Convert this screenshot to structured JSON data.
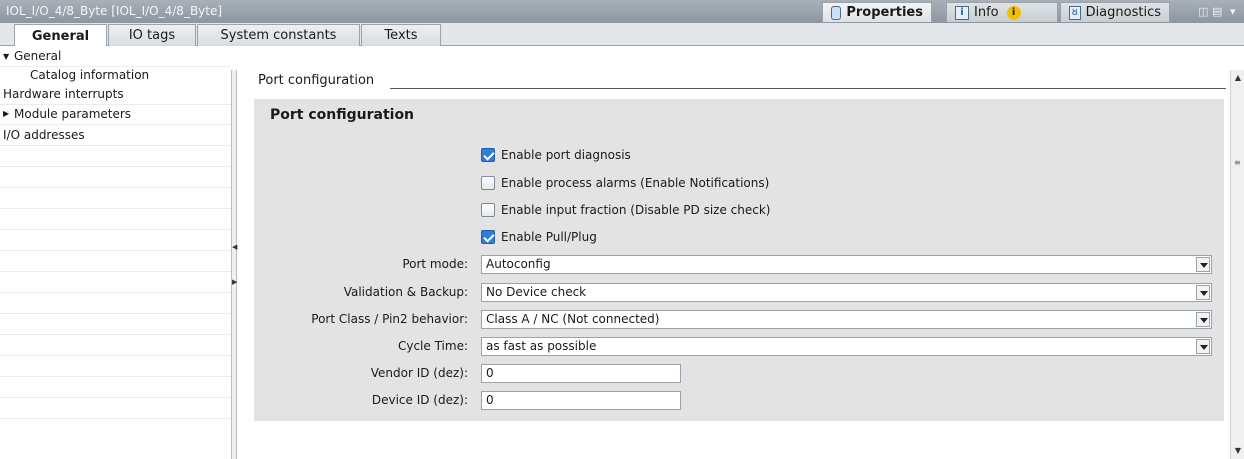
{
  "window": {
    "title": "IOL_I/O_4/8_Byte [IOL_I/O_4/8_Byte]",
    "tabs": {
      "properties": "Properties",
      "info": "Info",
      "info_badge": "i",
      "diagnostics": "Diagnostics"
    }
  },
  "subtabs": [
    "General",
    "IO tags",
    "System constants",
    "Texts"
  ],
  "tree": {
    "general": "General",
    "catalog": "Catalog information",
    "hw_interrupts": "Hardware interrupts",
    "module_params": "Module parameters",
    "io_addresses": "I/O addresses"
  },
  "section": {
    "header": "Port configuration",
    "panel_title": "Port configuration"
  },
  "checkboxes": [
    {
      "label": "Enable port diagnosis",
      "checked": true
    },
    {
      "label": "Enable process alarms (Enable Notifications)",
      "checked": false
    },
    {
      "label": "Enable input fraction (Disable PD size check)",
      "checked": false
    },
    {
      "label": "Enable Pull/Plug",
      "checked": true
    }
  ],
  "fields": {
    "port_mode": {
      "label": "Port mode:",
      "value": "Autoconfig"
    },
    "validation": {
      "label": "Validation & Backup:",
      "value": "No Device check"
    },
    "port_class": {
      "label": "Port Class / Pin2 behavior:",
      "value": "Class A / NC (Not connected)"
    },
    "cycle_time": {
      "label": "Cycle Time:",
      "value": "as fast as possible"
    },
    "vendor_id": {
      "label": "Vendor ID (dez):",
      "value": "0"
    },
    "device_id": {
      "label": "Device ID (dez):",
      "value": "0"
    }
  },
  "colors": {
    "checked": "#2f7fd6",
    "panel": "#e3e3e3",
    "titlebar": "#8d969f"
  }
}
